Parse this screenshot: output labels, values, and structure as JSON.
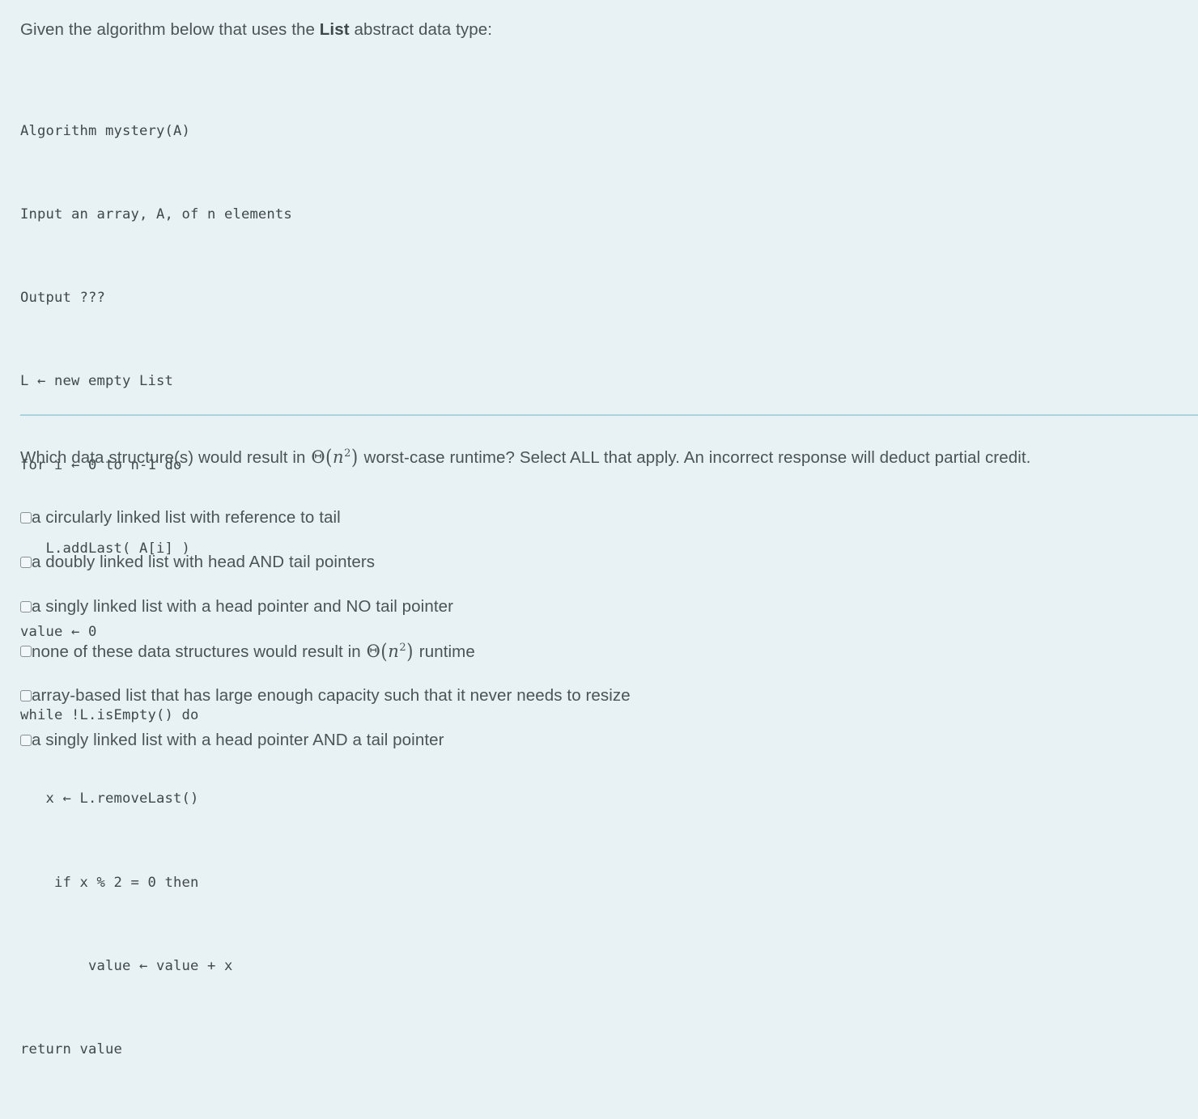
{
  "intro": {
    "before": "Given the algorithm below that uses the ",
    "bold": "List",
    "after": " abstract data type:"
  },
  "algorithm": {
    "lines": [
      "Algorithm mystery(A)",
      "Input an array, A, of n elements",
      "Output ???",
      "L ← new empty List",
      "for i ← 0 to n-1 do",
      "   L.addLast( A[i] )",
      "value ← 0",
      "while !L.isEmpty() do",
      "   x ← L.removeLast()",
      "    if x % 2 = 0 then",
      "        value ← value + x",
      "return value"
    ]
  },
  "question": {
    "part1": "Which data structure(s) would result in ",
    "math": "Θ(n²)",
    "math_parts": {
      "theta": "Θ",
      "open": "(",
      "var": "n",
      "exponent": "2",
      "close": ")"
    },
    "part2": " worst-case runtime? Select ALL that apply. An incorrect response will deduct partial credit."
  },
  "options": [
    {
      "label": "a circularly linked list with reference to tail",
      "checked": false,
      "has_math": false
    },
    {
      "label": "a doubly linked list with head AND tail pointers",
      "checked": false,
      "has_math": false
    },
    {
      "label": "a singly linked list with a head pointer and NO tail pointer",
      "checked": false,
      "has_math": false
    },
    {
      "label": "none of these data structures would result in ",
      "checked": false,
      "has_math": true,
      "label_after": " runtime"
    },
    {
      "label": "array-based list that has large enough capacity such that it never needs to resize",
      "checked": false,
      "has_math": false
    },
    {
      "label": "a singly linked list with a head pointer AND a tail pointer",
      "checked": false,
      "has_math": false
    }
  ],
  "colors": {
    "background": "#e8f1f4",
    "text": "#4a5356",
    "code_text": "#3f484b",
    "divider": "#a9d3dd",
    "checkbox_border": "#8b9295"
  }
}
